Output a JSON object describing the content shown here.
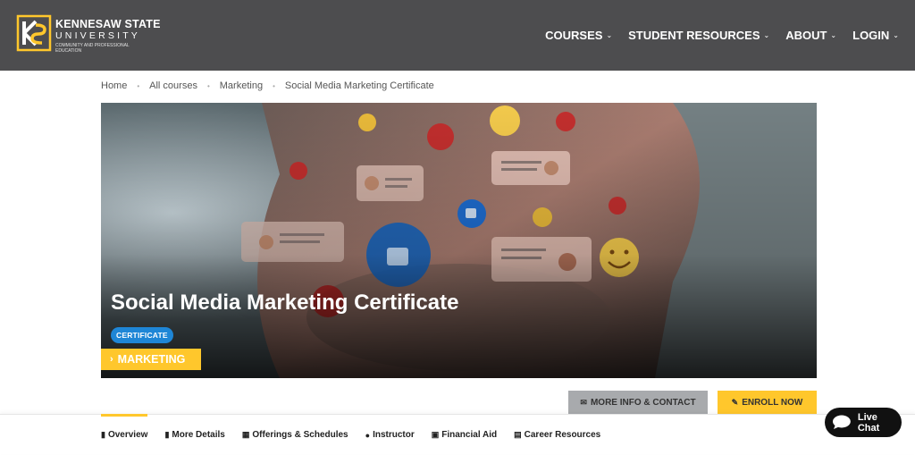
{
  "header": {
    "logo": {
      "title": "KENNESAW STATE",
      "subtitle": "UNIVERSITY",
      "tagline": "COMMUNITY AND PROFESSIONAL EDUCATION",
      "mark_icon": "ksu-logo-icon"
    },
    "nav": [
      {
        "label": "COURSES"
      },
      {
        "label": "STUDENT RESOURCES"
      },
      {
        "label": "ABOUT"
      },
      {
        "label": "LOGIN"
      }
    ]
  },
  "breadcrumb": {
    "items": [
      "Home",
      "All courses",
      "Marketing",
      "Social Media Marketing Certificate"
    ]
  },
  "hero": {
    "title": "Social Media Marketing Certificate",
    "badge": "CERTIFICATE",
    "category": "MARKETING",
    "category_icon": "chevron-right-icon"
  },
  "actions": {
    "more_info": "MORE INFO & CONTACT",
    "more_info_icon": "envelope-icon",
    "enroll": "ENROLL NOW",
    "enroll_icon": "pencil-icon"
  },
  "tabs": [
    {
      "label": "Overview",
      "icon": "bookmark-icon"
    },
    {
      "label": "More Details",
      "icon": "bookmark-icon"
    },
    {
      "label": "Offerings & Schedules",
      "icon": "calendar-icon"
    },
    {
      "label": "Instructor",
      "icon": "user-icon"
    },
    {
      "label": "Financial Aid",
      "icon": "money-icon"
    },
    {
      "label": "Career Resources",
      "icon": "briefcase-icon"
    }
  ],
  "livechat": {
    "label": "Live Chat",
    "icon": "chat-bubble-icon"
  },
  "colors": {
    "header_bg": "#4d4d4f",
    "accent_gold": "#ffc72c",
    "badge_blue": "#1e86d6",
    "info_button": "#a8aaad"
  }
}
